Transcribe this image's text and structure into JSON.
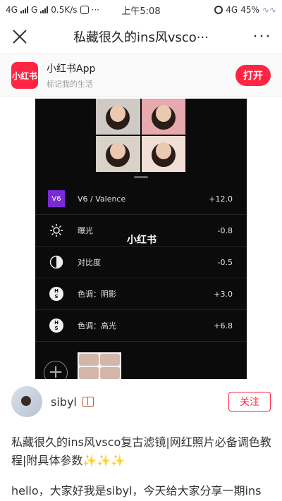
{
  "status_bar": {
    "network1": "4G",
    "network2": "G",
    "speed": "0.5K/s",
    "more": "···",
    "time": "上午5:08",
    "network3": "4G",
    "battery": "45%"
  },
  "nav": {
    "title": "私藏很久的ins风vsco···",
    "more": "···"
  },
  "app_banner": {
    "logo_text": "小红书",
    "app_name": "小红书App",
    "tagline": "标记我的生活",
    "open_label": "打开"
  },
  "photo": {
    "watermark": "小红书",
    "adjustments": [
      {
        "icon": "v6-badge",
        "badge": "V6",
        "label": "V6 / Valence",
        "value": "+12.0"
      },
      {
        "icon": "exposure-icon",
        "label": "曝光",
        "value": "-0.8"
      },
      {
        "icon": "contrast-icon",
        "label": "对比度",
        "value": "-0.5"
      },
      {
        "icon": "tone-hs-icon",
        "label": "色调：阴影",
        "value": "+3.0"
      },
      {
        "icon": "tone-hs-icon",
        "label": "色调：高光",
        "value": "+6.8"
      }
    ]
  },
  "author": {
    "name": "sibyl",
    "follow_label": "关注"
  },
  "note": {
    "title": "私藏很久的ins风vsco复古滤镜|网红照片必备调色教程|附具体参数✨✨✨",
    "body": "hello，大家好我是sibyl，今天给大家分享一期ins"
  }
}
